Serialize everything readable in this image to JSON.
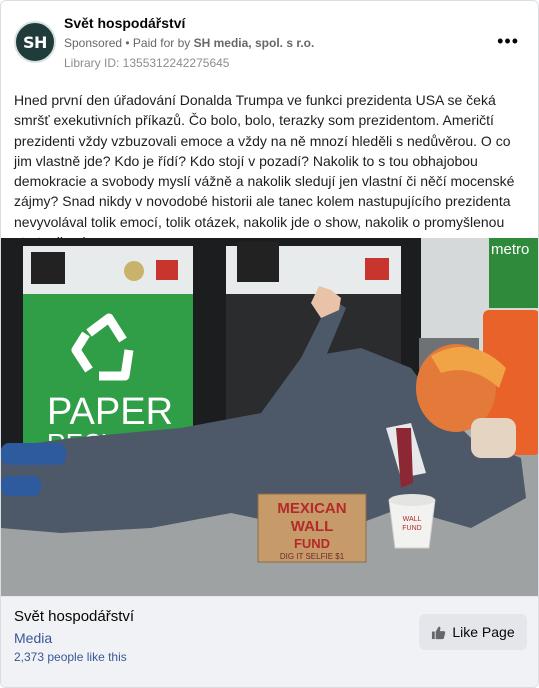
{
  "header": {
    "avatar_text": "SH",
    "page_name": "Svět hospodářství",
    "sponsored_label": "Sponsored",
    "separator": " • ",
    "paid_for_prefix": "Paid for by ",
    "paid_for_name": "SH media, spol. s r.o.",
    "library_id": "Library ID: 1355312242275645",
    "more_icon": "more-dots-icon"
  },
  "post": {
    "text": "Hned první den úřadování Donalda Trumpa ve funkci prezidenta USA se čeká smršť exekutivních příkazů. Čo bolo, bolo, terazky som prezidentom. Američtí prezidenti vždy vzbuzovali emoce a vždy na ně mnozí hleděli s nedůvěrou. O co jim vlastně jde? Kdo je řídí? Kdo stojí v pozadí? Nakolik to s tou obhajobou demokracie a svobody myslí vážně a nakolik sledují jen vlastní či něčí mocenské zájmy? Snad nikdy v novodobé historii ale tanec kolem nastupujícího prezidenta nevyvolával tolik emocí, tolik otázek, nakolik jde o show, nakolik o promyšlenou strategii nebo…"
  },
  "image": {
    "bin_left_label_1": "PAPER",
    "bin_left_label_2": "RECYCLING",
    "sign_line_1": "MEXICAN",
    "sign_line_2": "WALL",
    "sign_line_3": "FUND",
    "sign_line_4": "DIG IT SELFIE $1",
    "cup_line_1": "WALL",
    "cup_line_2": "FUND",
    "metro_label": "metro"
  },
  "footer": {
    "page_name": "Svět hospodářství",
    "category": "Media",
    "likes": "2,373 people like this",
    "like_button": "Like Page",
    "like_icon": "thumbs-up-icon"
  },
  "colors": {
    "link": "#385898",
    "muted": "#65676b",
    "footer_bg": "#f0f2f5",
    "bin_green": "#2e9e43",
    "suit_gray": "#4d5868"
  }
}
